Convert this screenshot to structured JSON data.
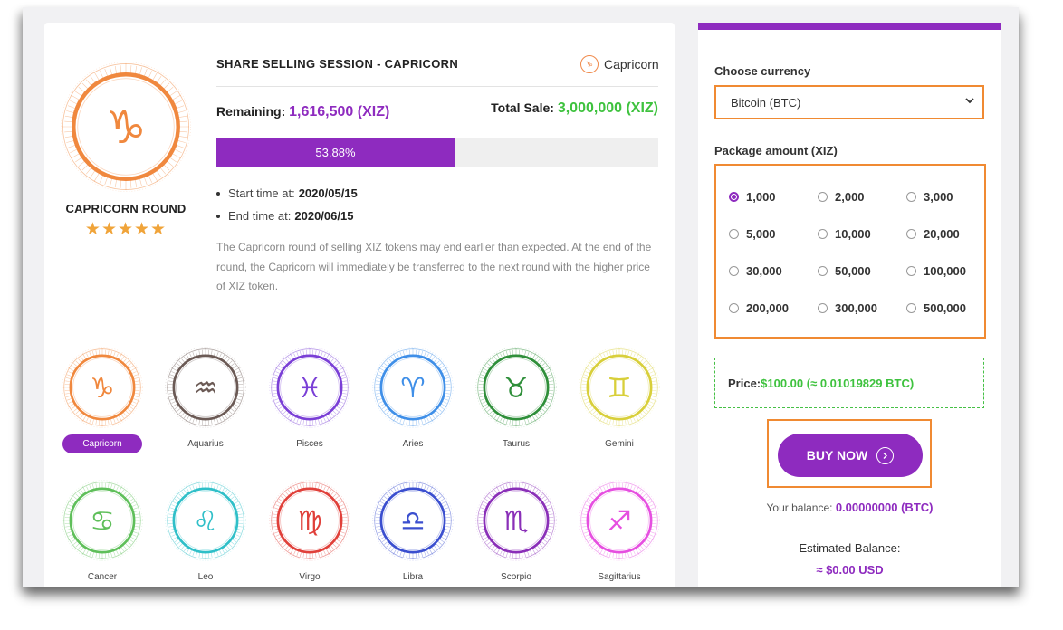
{
  "session": {
    "title": "SHARE SELLING SESSION - CAPRICORN",
    "sign_chip_label": "Capricorn",
    "sign_chip_glyph": "♑",
    "round_name": "CAPRICORN ROUND",
    "stars": "★★★★★",
    "rating": 5,
    "remaining_label": "Remaining:",
    "remaining_value": "1,616,500 (XIZ)",
    "total_label": "Total Sale:",
    "total_value": "3,000,000 (XIZ)",
    "progress_percent": 53.88,
    "progress_text": "53.88%",
    "start_label": "Start time at:",
    "start_value": "2020/05/15",
    "end_label": "End time at:",
    "end_value": "2020/06/15",
    "description": "The Capricorn round of selling XIZ tokens may end earlier than expected. At the end of the round, the Capricorn will immediately be transferred to the next round with the higher price of XIZ token.",
    "hero_glyph": "♑",
    "hero_color": "#f0883e"
  },
  "signs": [
    {
      "name": "Capricorn",
      "glyph": "♑",
      "color": "#f0883e",
      "active": true
    },
    {
      "name": "Aquarius",
      "glyph": "♒",
      "color": "#6b5a55",
      "active": false
    },
    {
      "name": "Pisces",
      "glyph": "♓",
      "color": "#7a3fd6",
      "active": false
    },
    {
      "name": "Aries",
      "glyph": "♈",
      "color": "#3f8fe8",
      "active": false
    },
    {
      "name": "Taurus",
      "glyph": "♉",
      "color": "#2f8f3a",
      "active": false
    },
    {
      "name": "Gemini",
      "glyph": "♊",
      "color": "#d8cf3a",
      "active": false
    },
    {
      "name": "Cancer",
      "glyph": "♋",
      "color": "#5fbf5a",
      "active": false
    },
    {
      "name": "Leo",
      "glyph": "♌",
      "color": "#2fbfc8",
      "active": false
    },
    {
      "name": "Virgo",
      "glyph": "♍",
      "color": "#e0403a",
      "active": false
    },
    {
      "name": "Libra",
      "glyph": "♎",
      "color": "#3b4fcf",
      "active": false
    },
    {
      "name": "Scorpio",
      "glyph": "♏",
      "color": "#8a2fb8",
      "active": false
    },
    {
      "name": "Sagittarius",
      "glyph": "♐",
      "color": "#e64fe0",
      "active": false
    }
  ],
  "panel": {
    "currency_label": "Choose currency",
    "currency_selected": "Bitcoin (BTC)",
    "package_label": "Package amount (XIZ)",
    "packages": [
      "1,000",
      "2,000",
      "3,000",
      "5,000",
      "10,000",
      "20,000",
      "30,000",
      "50,000",
      "100,000",
      "200,000",
      "300,000",
      "500,000"
    ],
    "selected_package": "1,000",
    "price_label": "Price:",
    "price_value": "$100.00 (≈ 0.01019829 BTC)",
    "buy_label": "BUY NOW",
    "balance_label": "Your balance:",
    "balance_value": "0.00000000 (BTC)",
    "estimated_label": "Estimated Balance:",
    "estimated_value": "≈ $0.00 USD"
  },
  "colors": {
    "accent": "#8e2bbf",
    "highlight": "#f08a32",
    "success": "#3ec23e",
    "star": "#f0a43a"
  }
}
